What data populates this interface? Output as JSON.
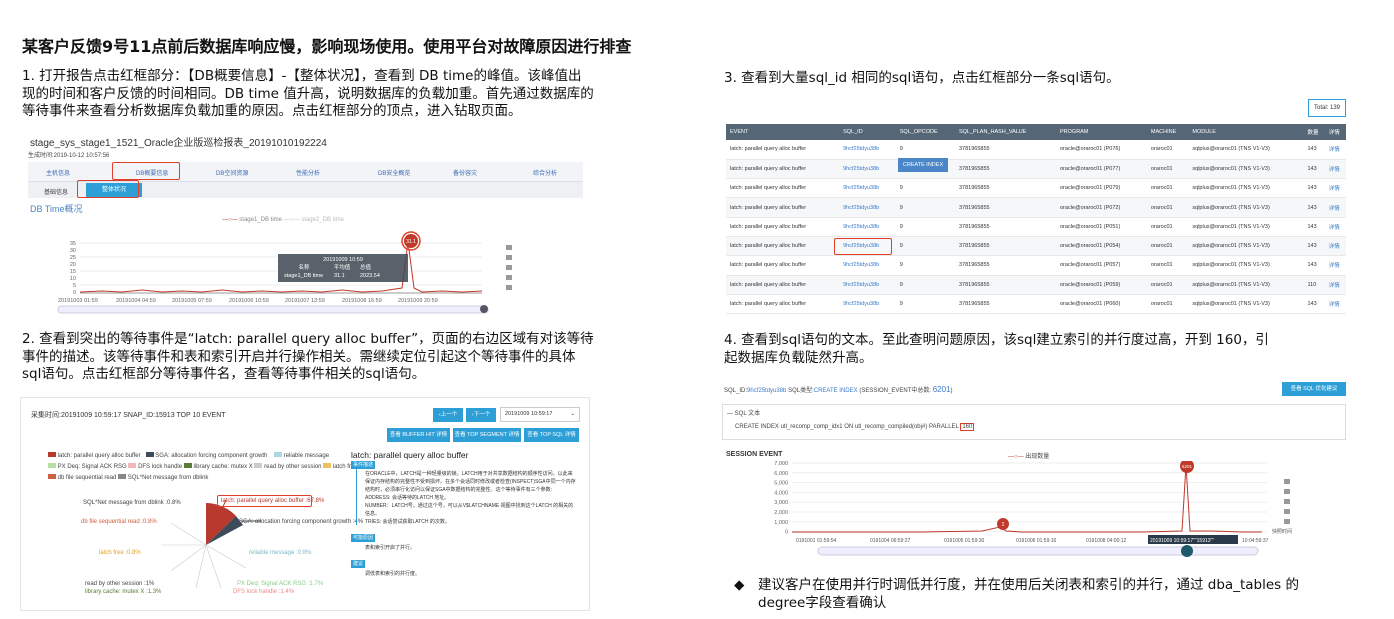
{
  "title": "某客户反馈9号11点前后数据库响应慢，影响现场使用。使用平台对故障原因进行排查",
  "step1": {
    "lines": [
      "1. 打开报告点击红框部分：【DB概要信息】-【整体状况】，查看到 DB time的峰值。该峰值出",
      "现的时间和客户反馈的时间相同。DB time 值升高，说明数据库的负载加重。首先通过数据库的",
      "等待事件来查看分析数据库负载加重的原因。点击红框部分的顶点，进入钻取页面。"
    ]
  },
  "step2": {
    "lines": [
      "2. 查看到突出的等待事件是“latch: parallel query alloc buffer”，页面的右边区域有对该等待",
      "事件的描述。该等待事件和表和索引开启并行操作相关。需继续定位引起这个等待事件的具体",
      "sql语句。点击红框部分等待事件名，查看等待事件相关的sql语句。"
    ]
  },
  "step3": {
    "lines": [
      "3. 查看到大量sql_id 相同的sql语句，点击红框部分一条sql语句。"
    ]
  },
  "step4": {
    "lines": [
      "4. 查看到sql语句的文本。至此查明问题原因，该sql建立索引的并行度过高，开到 160，引",
      "起数据库负载陡然升高。"
    ]
  },
  "conclusion": {
    "bullet": "◆",
    "lines": [
      "建议客户在使用并行时调低并行度，并在使用后关闭表和索引的并行，通过 dba_tables 的",
      "degree字段查看确认"
    ]
  },
  "panel1": {
    "report_title": "stage_sys_stage1_1521_Oracle企业版巡检报表_20191010192224",
    "generated": "生成时间:2019-10-12 10:57:56",
    "nav": [
      "主机信息",
      "DB概要信息",
      "DB空间资源",
      "性能分析",
      "DB安全概览",
      "备份容灾",
      "综合分析"
    ],
    "subtabs": [
      "基础信息",
      "整体状况"
    ],
    "dbtime_title": "DB Time概况",
    "legend": [
      "stage1_DB time",
      "stage2_DB time"
    ],
    "tooltip": {
      "time": "20191009 10:59",
      "headers": [
        "名称",
        "平均值",
        "总值"
      ],
      "row": [
        "stage1_DB time",
        "31.1",
        "2023.54"
      ]
    },
    "peak_label": "31.1"
  },
  "panel2": {
    "header": "采集时间:20191009 10:59:17  SNAP_ID:15913 TOP 10 EVENT",
    "prev": "上一个",
    "next": "下一个",
    "select": "20191009 10:59:17",
    "buttons": [
      "查看 BUFFER HIT 详情",
      "查看 TOP SEGMENT 详情",
      "查看 TOP SQL 详情"
    ],
    "legend": [
      "latch: parallel query alloc buffer",
      "SGA: allocation forcing component growth",
      "reliable message",
      "PX Deq: Signal ACK RSG",
      "DFS lock handle",
      "library cache: mutex X",
      "read by other session",
      "latch free",
      "db file sequential read",
      "SQL*Net message from dblink"
    ],
    "slice_labels": [
      "SQL*Net message from dblink :0.8%",
      "latch: parallel query alloc buffer :67.8%",
      "db file sequential read :0.8%",
      "SGA: allocation forcing component growth :4%",
      "latch free :0.8%",
      "reliable message :0.8%",
      "read by other session :1%",
      "library cache: mutex X :1.3%",
      "PX Deq: Signal ACK RSG :1.7%",
      "DFS lock handle :1.4%"
    ],
    "event_title": "latch: parallel query alloc buffer",
    "tags": [
      "事件描述",
      "可能原因",
      "建议"
    ],
    "desc": [
      "在ORACLE中，LATCH是一种轻量级的锁。LATCH用于对共享数据结构的顺序性访问。以此来",
      "保证内存结构的完整性不受到损坏。在多个会话同时修改或者检查(INSPECT)SGA中同一个内存",
      "结构时，必须串行化访问以保证SGA中数据结构的完整性。这个等待事件有三个参数:",
      "ADDRESS: 会话等待的LATCH 地址。",
      "NUMBER：LATCH号，通过这个号，可以从V$LATCHNAME 视图中找到这个LATCH 的相关的",
      "信息。",
      "TRIES: 会话尝试获取LATCH 的次数。"
    ],
    "reason": "表和索引开启了并行。",
    "advice": "调低表和索引的并行度。"
  },
  "panel3": {
    "total": "Total: 139",
    "tooltip": "CREATE INDEX",
    "columns": [
      "EVENT",
      "SQL_ID",
      "SQL_OPCODE",
      "SQL_PLAN_HASH_VALUE",
      "PROGRAM",
      "MACHINE",
      "MODULE",
      "数量",
      "详情"
    ],
    "rows": [
      [
        "latch: parallel query alloc buffer",
        "9hcf25tdyu38b",
        "9",
        "3781965855",
        "oracle@oraroc01 (P076)",
        "oraroc01",
        "sqlplus@oraroc01 (TNS V1-V3)",
        "143",
        "详情"
      ],
      [
        "latch: parallel query alloc buffer",
        "9hcf25tdyu38b",
        "9",
        "3781965855",
        "oracle@oraroc01 (P077)",
        "oraroc01",
        "sqlplus@oraroc01 (TNS V1-V3)",
        "143",
        "详情"
      ],
      [
        "latch: parallel query alloc buffer",
        "9hcf25tdyu38b",
        "9",
        "3781965855",
        "oracle@oraroc01 (P079)",
        "oraroc01",
        "sqlplus@oraroc01 (TNS V1-V3)",
        "143",
        "详情"
      ],
      [
        "latch: parallel query alloc buffer",
        "9hcf25tdyu38b",
        "9",
        "3781965855",
        "oracle@oraroc01 (P072)",
        "oraroc01",
        "sqlplus@oraroc01 (TNS V1-V3)",
        "143",
        "详情"
      ],
      [
        "latch: parallel query alloc buffer",
        "9hcf25tdyu38b",
        "9",
        "3781965855",
        "oracle@oraroc01 (P051)",
        "oraroc01",
        "sqlplus@oraroc01 (TNS V1-V3)",
        "143",
        "详情"
      ],
      [
        "latch: parallel query alloc buffer",
        "9hcf25tdyu38b",
        "9",
        "3781965855",
        "oracle@oraroc01 (P054)",
        "oraroc01",
        "sqlplus@oraroc01 (TNS V1-V3)",
        "143",
        "详情"
      ],
      [
        "latch: parallel query alloc buffer",
        "9hcf25tdyu38b",
        "9",
        "3781965855",
        "oracle@oraroc01 (P057)",
        "oraroc01",
        "sqlplus@oraroc01 (TNS V1-V3)",
        "143",
        "详情"
      ],
      [
        "latch: parallel query alloc buffer",
        "9hcf25tdyu38b",
        "9",
        "3781965855",
        "oracle@oraroc01 (P059)",
        "oraroc01",
        "sqlplus@oraroc01 (TNS V1-V3)",
        "110",
        "详情"
      ],
      [
        "latch: parallel query alloc buffer",
        "9hcf25tdyu38b",
        "9",
        "3781965855",
        "oracle@oraroc01 (P060)",
        "oraroc01",
        "sqlplus@oraroc01 (TNS V1-V3)",
        "143",
        "详情"
      ]
    ]
  },
  "panel4": {
    "header_prefix": "SQL_ID:",
    "sql_id": "9hcf25tdyu38b",
    "type_label": "SQL类型:",
    "type": "CREATE INDEX",
    "session_label": "(SESSION_EVENT中总数:",
    "session_count": "6201",
    "session_close": ")",
    "optimize_button": "查看 SQL 优化建议",
    "sql_text_label": "SQL 文本",
    "sql_text": "CREATE INDEX utl_recomp_comp_idx1 ON utl_recomp_compiled(obj#) PARALLEL",
    "parallel": "160",
    "session_event": "SESSION EVENT",
    "legend": "出现数量",
    "quick_time": "快照时间",
    "peak": "6201",
    "small": "2",
    "x_ticks": [
      "0191001 01:59:54",
      "0191004 06:59:27",
      "0191005 01:59:30",
      "0191006 01:59:16",
      "0191007 00:00:15",
      "0191008 04:00:12",
      "20191009 10:59:17",
      "10:04:59:37"
    ],
    "y_ticks": [
      "7,000",
      "6,000",
      "5,000",
      "4,000",
      "3,000",
      "2,000",
      "1,000",
      "0"
    ],
    "highlight_tick": "20191009 10:59:17\"\"15913\"\""
  }
}
